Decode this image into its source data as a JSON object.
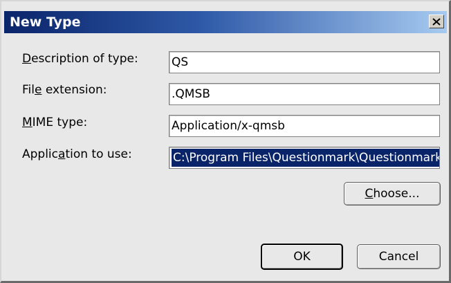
{
  "window": {
    "title": "New Type",
    "close_icon": "close-x-icon"
  },
  "form": {
    "description": {
      "label_pre": "",
      "label_mnemonic": "D",
      "label_post": "escription of type:",
      "value": "QS"
    },
    "extension": {
      "label_pre": "Fil",
      "label_mnemonic": "e",
      "label_post": " extension:",
      "value": ".QMSB"
    },
    "mime": {
      "label_pre": "",
      "label_mnemonic": "M",
      "label_post": "IME type:",
      "value": "Application/x-qmsb"
    },
    "application": {
      "label_pre": "Applic",
      "label_mnemonic": "a",
      "label_post": "tion to use:",
      "value": "C:\\Program Files\\Questionmark\\Questionmark"
    }
  },
  "buttons": {
    "choose": {
      "pre": "",
      "mnemonic": "C",
      "post": "hoose..."
    },
    "ok": {
      "label": "OK"
    },
    "cancel": {
      "label": "Cancel"
    }
  },
  "colors": {
    "title_gradient_start": "#0a246a",
    "title_gradient_end": "#a6caf0",
    "selection": "#0a246a"
  }
}
